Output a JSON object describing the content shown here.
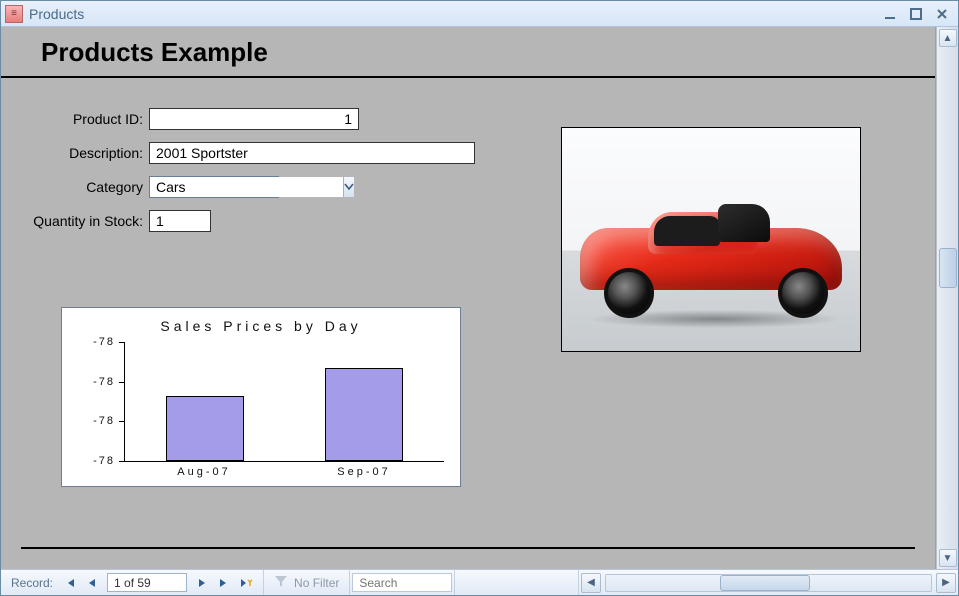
{
  "window": {
    "title": "Products"
  },
  "form": {
    "heading": "Products Example",
    "fields": {
      "product_id": {
        "label": "Product ID:",
        "value": "1"
      },
      "description": {
        "label": "Description:",
        "value": "2001 Sportster"
      },
      "category": {
        "label": "Category",
        "value": "Cars"
      },
      "quantity": {
        "label": "Quantity in Stock:",
        "value": "1"
      }
    }
  },
  "chart_data": {
    "type": "bar",
    "title": "Sales Prices by Day",
    "categories": [
      "Aug-07",
      "Sep-07"
    ],
    "values": [
      -78,
      -78
    ],
    "yticks": [
      "-78",
      "-78",
      "-78",
      "-78"
    ],
    "bar_heights_pct": [
      55,
      78
    ]
  },
  "nav": {
    "label": "Record:",
    "position": "1 of 59",
    "filter_label": "No Filter",
    "search_placeholder": "Search"
  },
  "icons": {
    "app": "≡",
    "first": "first-record-icon",
    "prev": "prev-record-icon",
    "next": "next-record-icon",
    "last": "last-record-icon",
    "new": "new-record-icon"
  }
}
